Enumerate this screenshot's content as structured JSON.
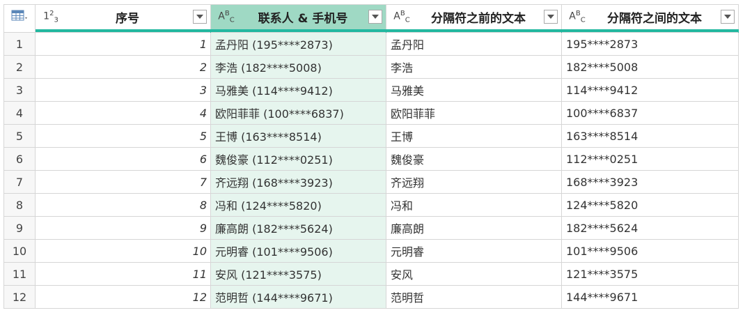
{
  "columns": [
    {
      "type_icon": "123",
      "label": "序号"
    },
    {
      "type_icon": "ABC",
      "label": "联系人 & 手机号"
    },
    {
      "type_icon": "ABC",
      "label": "分隔符之前的文本"
    },
    {
      "type_icon": "ABC",
      "label": "分隔符之间的文本"
    }
  ],
  "colors": {
    "accent_bar": "#22b8a0",
    "selected_header": "#9fd9c4",
    "selected_column": "#e6f5ee"
  },
  "corner_icon": "table-icon",
  "rows": [
    {
      "n": "1",
      "seq": "1",
      "contact": "孟丹阳 (195****2873)",
      "before": "孟丹阳",
      "between": "195****2873"
    },
    {
      "n": "2",
      "seq": "2",
      "contact": "李浩 (182****5008)",
      "before": "李浩",
      "between": "182****5008"
    },
    {
      "n": "3",
      "seq": "3",
      "contact": "马雅美 (114****9412)",
      "before": "马雅美",
      "between": "114****9412"
    },
    {
      "n": "4",
      "seq": "4",
      "contact": "欧阳菲菲 (100****6837)",
      "before": "欧阳菲菲",
      "between": "100****6837"
    },
    {
      "n": "5",
      "seq": "5",
      "contact": "王博 (163****8514)",
      "before": "王博",
      "between": "163****8514"
    },
    {
      "n": "6",
      "seq": "6",
      "contact": "魏俊豪 (112****0251)",
      "before": "魏俊豪",
      "between": "112****0251"
    },
    {
      "n": "7",
      "seq": "7",
      "contact": "齐远翔 (168****3923)",
      "before": "齐远翔",
      "between": "168****3923"
    },
    {
      "n": "8",
      "seq": "8",
      "contact": "冯和 (124****5820)",
      "before": "冯和",
      "between": "124****5820"
    },
    {
      "n": "9",
      "seq": "9",
      "contact": "廉高朗 (182****5624)",
      "before": "廉高朗",
      "between": "182****5624"
    },
    {
      "n": "10",
      "seq": "10",
      "contact": "元明睿 (101****9506)",
      "before": "元明睿",
      "between": "101****9506"
    },
    {
      "n": "11",
      "seq": "11",
      "contact": "安风 (121****3575)",
      "before": "安风",
      "between": "121****3575"
    },
    {
      "n": "12",
      "seq": "12",
      "contact": "范明哲 (144****9671)",
      "before": "范明哲",
      "between": "144****9671"
    }
  ]
}
